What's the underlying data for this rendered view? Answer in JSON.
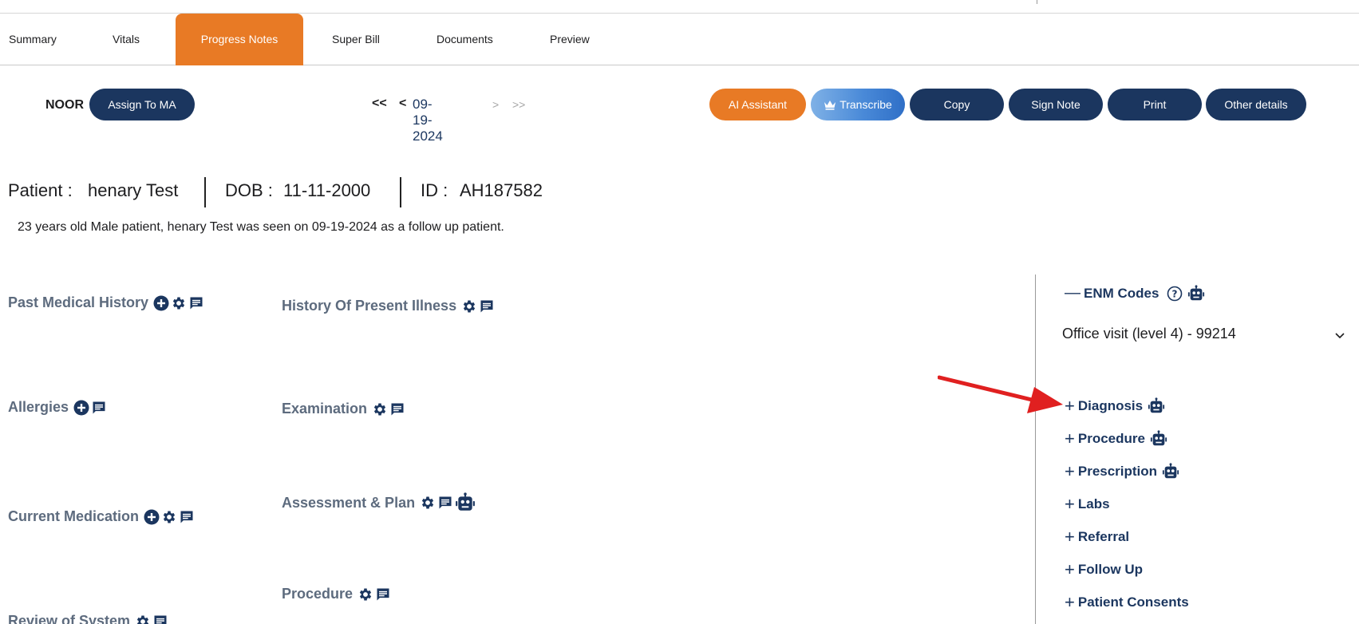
{
  "tabs": [
    {
      "label": "Summary"
    },
    {
      "label": "Vitals"
    },
    {
      "label": "Progress Notes"
    },
    {
      "label": "Super Bill"
    },
    {
      "label": "Documents"
    },
    {
      "label": "Preview"
    }
  ],
  "toolbar": {
    "provider": "NOOR",
    "assign_label": "Assign To MA",
    "nav_first": "<<",
    "nav_prev": "<",
    "date": "09-19-2024",
    "nav_next": ">",
    "nav_last": ">>",
    "ai_assistant": "AI Assistant",
    "transcribe": "Transcribe",
    "copy": "Copy",
    "sign_note": "Sign Note",
    "print": "Print",
    "other_details": "Other details"
  },
  "patient": {
    "name_label": "Patient :",
    "name": "henary Test",
    "dob_label": "DOB :",
    "dob": "11-11-2000",
    "id_label": "ID :",
    "id": "AH187582",
    "summary": "23 years old Male patient, henary Test was seen on 09-19-2024 as a follow up patient."
  },
  "sections": {
    "past_medical_history": "Past Medical History",
    "allergies": "Allergies",
    "current_medication": "Current Medication",
    "review_of_system": "Review of System",
    "hpi": "History Of Present Illness",
    "examination": "Examination",
    "assessment_plan": "Assessment & Plan",
    "procedure": "Procedure"
  },
  "right_panel": {
    "enm_title": "ENM Codes",
    "enm_selected": "Office visit (level 4) - 99214",
    "items": [
      {
        "label": "Diagnosis"
      },
      {
        "label": "Procedure"
      },
      {
        "label": "Prescription"
      },
      {
        "label": "Labs"
      },
      {
        "label": "Referral"
      },
      {
        "label": "Follow Up"
      },
      {
        "label": "Patient Consents"
      }
    ]
  },
  "colors": {
    "navy": "#1b365f",
    "orange": "#e87a25",
    "section_gray": "#5d6b7e",
    "arrow_red": "#e02020"
  },
  "icons": [
    "plus-circle-icon",
    "gear-icon",
    "comment-icon",
    "robot-icon",
    "help-circle-icon",
    "chevron-down-icon",
    "crown-icon"
  ]
}
